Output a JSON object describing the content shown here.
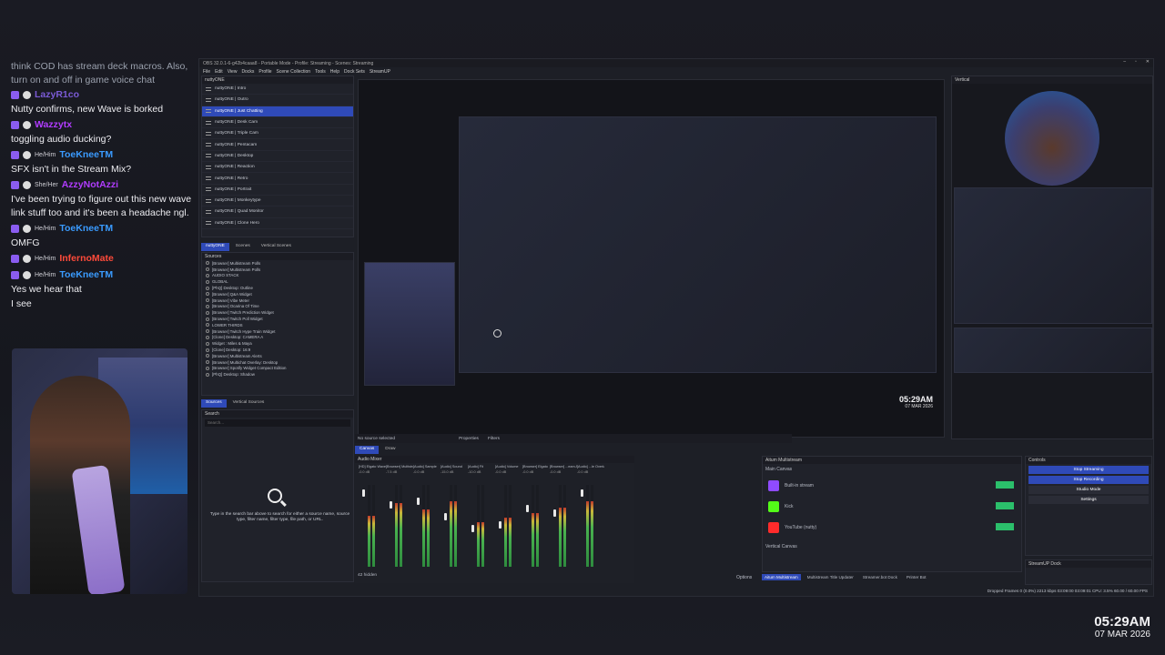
{
  "chat": {
    "intro": "think COD has stream deck macros. Also, turn on and off in game voice chat",
    "messages": [
      {
        "pronoun": "",
        "nick": "LazyR1co",
        "color": "#7b5bd6",
        "text": "Nutty confirms, new Wave is borked"
      },
      {
        "pronoun": "",
        "nick": "Wazzytx",
        "color": "#b13cff",
        "text": "toggling audio ducking?"
      },
      {
        "pronoun": "He/Him",
        "nick": "ToeKneeTM",
        "color": "#3a9bff",
        "text": "SFX isn't in the Stream Mix?"
      },
      {
        "pronoun": "She/Her",
        "nick": "AzzyNotAzzi",
        "color": "#b13cff",
        "text": "I've been trying to figure out this new wave link stuff too and it's been a headache ngl."
      },
      {
        "pronoun": "He/Him",
        "nick": "ToeKneeTM",
        "color": "#3a9bff",
        "text": "OMFG"
      },
      {
        "pronoun": "He/Him",
        "nick": "InfernoMate",
        "color": "#ff4a3a",
        "text": ""
      },
      {
        "pronoun": "He/Him",
        "nick": "ToeKneeTM",
        "color": "#3a9bff",
        "text": "Yes we hear that"
      },
      {
        "pronoun": "",
        "nick": "",
        "color": "",
        "text": "I see"
      }
    ]
  },
  "clock": {
    "time": "05:29AM",
    "date": "07 MAR 2026"
  },
  "obs": {
    "title": "OBS 32.0.1-6-g42b4caaa8 - Portable Mode - Profile: Streaming - Scenes: Streaming",
    "menu": [
      "File",
      "Edit",
      "View",
      "Docks",
      "Profile",
      "Scene Collection",
      "Tools",
      "Help",
      "Dock Sets",
      "StreamUP"
    ],
    "scenes_header": "nuttyONE",
    "scenes": [
      "nuttyONE | Intro",
      "nuttyONE | Outro",
      "nuttyONE | Just Chatting",
      "nuttyONE | Desk Cam",
      "nuttyONE | Triple Cam",
      "nuttyONE | Pentacam",
      "nuttyONE | Desktop",
      "nuttyONE | Reaction",
      "nuttyONE | Retro",
      "nuttyONE | Portrait",
      "nuttyONE | Monkeytype",
      "nuttyONE | Quad Monitor",
      "nuttyONE | Clone Hero"
    ],
    "scene_tabs": [
      "nuttyONE",
      "Scenes",
      "Vertical Scenes"
    ],
    "sources_header": "Sources",
    "sources": [
      "[Browser] Multistream Polls",
      "[Browser] Multistream Polls",
      "AUDIO STACK",
      "GLOBAL",
      "[PhQ] Desktop: Outline",
      "[Browser] Q&A Widget",
      "[Browser] Vibe Meter",
      "[Browser] Ocarina Of Time",
      "[Browser] Twitch Prediction Widget",
      "[Browser] Twitch Poll Widget",
      "LOWER THIRDS",
      "[Browser] Twitch Hype Train Widget",
      "[Clone] Desktop: CAMERA A",
      "Widget : Miles & Maya",
      "[Clone] Desktop: 16:9",
      "[Browser] Multistream Alerts",
      "[Browser] Multichat Overlay: Desktop",
      "[Browser] Spotify Widget Compact Edition",
      "[PhQ] Desktop: Shadow"
    ],
    "source_tabs": [
      "Sources",
      "Vertical Sources"
    ],
    "search_header": "Search",
    "search_placeholder": "Search...",
    "search_hint": "Type in the search bar above to search for either a source name, source type, filter name, filter type, file path, or URL.",
    "preview_time": "05:29AM",
    "preview_date": "07 MAR 2026",
    "vertical_header": "Vertical",
    "no_source": "No source selected",
    "properties": "Properties",
    "filters": "Filters",
    "canvas_tabs": [
      "Canvas",
      "Draw"
    ],
    "mixer_header": "Audio Mixer",
    "mixer_channels": [
      "[HD] Elgato Wave:XLR",
      "[Browser] Multistream",
      "[Audio] Sample",
      "[Audio] Sound",
      "[Audio] Fit",
      "[Audio] Volume",
      "[Browser] Elgato",
      "[Browser] ...eam Alerts",
      "[Audio] ...le Overlay"
    ],
    "mixer_db": [
      "-0.0 dB",
      "-7.5 dB",
      "-0.0 dB",
      "-15.0 dB",
      "-10.0 dB",
      "-0.0 dB",
      "-0.0 dB",
      "-0.0 dB",
      "-0.0 dB"
    ],
    "mixer_hidden": "42 hidden",
    "mixer_options": "Options",
    "multistream_header": "Aitum Multistream",
    "main_canvas": "Main Canvas",
    "destinations": [
      {
        "name": "Built-in stream",
        "icon": "twitch-icon",
        "color": "#8f4bff"
      },
      {
        "name": "Kick",
        "icon": "kick-icon",
        "color": "#53fc18"
      },
      {
        "name": "YouTube (nutty)",
        "icon": "youtube-icon",
        "color": "#ff2b2b"
      }
    ],
    "vertical_canvas": "Vertical Canvas",
    "controls_header": "Controls",
    "controls": [
      "Stop Streaming",
      "Stop Recording",
      "Studio Mode",
      "Settings"
    ],
    "streamup_header": "StreamUP Dock",
    "bottom_tabs": [
      "Aitum Multistream",
      "Multistream Title Updater",
      "Streamer.bot Dock",
      "Printer Bot"
    ],
    "status": "Dropped Frames 0 (0.0%)   2213 kbps   03:09:00   03:09:01   CPU: 3.5%  60.00 / 60.00 FPS"
  }
}
